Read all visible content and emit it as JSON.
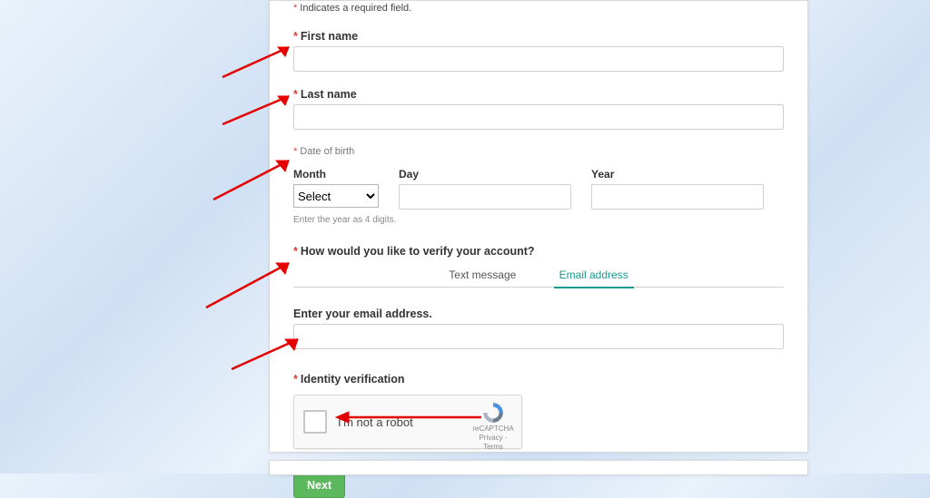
{
  "form": {
    "required_hint": "Indicates a required field.",
    "first_name_label": "First name",
    "first_name_value": "",
    "last_name_label": "Last name",
    "last_name_value": "",
    "dob_label": "Date of birth",
    "month_label": "Month",
    "month_placeholder": "Select",
    "day_label": "Day",
    "day_value": "",
    "year_label": "Year",
    "year_value": "",
    "year_hint": "Enter the year as 4 digits.",
    "verify_question": "How would you like to verify your account?",
    "tab_text": "Text message",
    "tab_email": "Email address",
    "email_label": "Enter your email address.",
    "email_value": "",
    "identity_label": "Identity verification",
    "recaptcha_text": "I'm not a robot",
    "recaptcha_brand": "reCAPTCHA",
    "recaptcha_links": "Privacy · Terms",
    "next_label": "Next"
  }
}
